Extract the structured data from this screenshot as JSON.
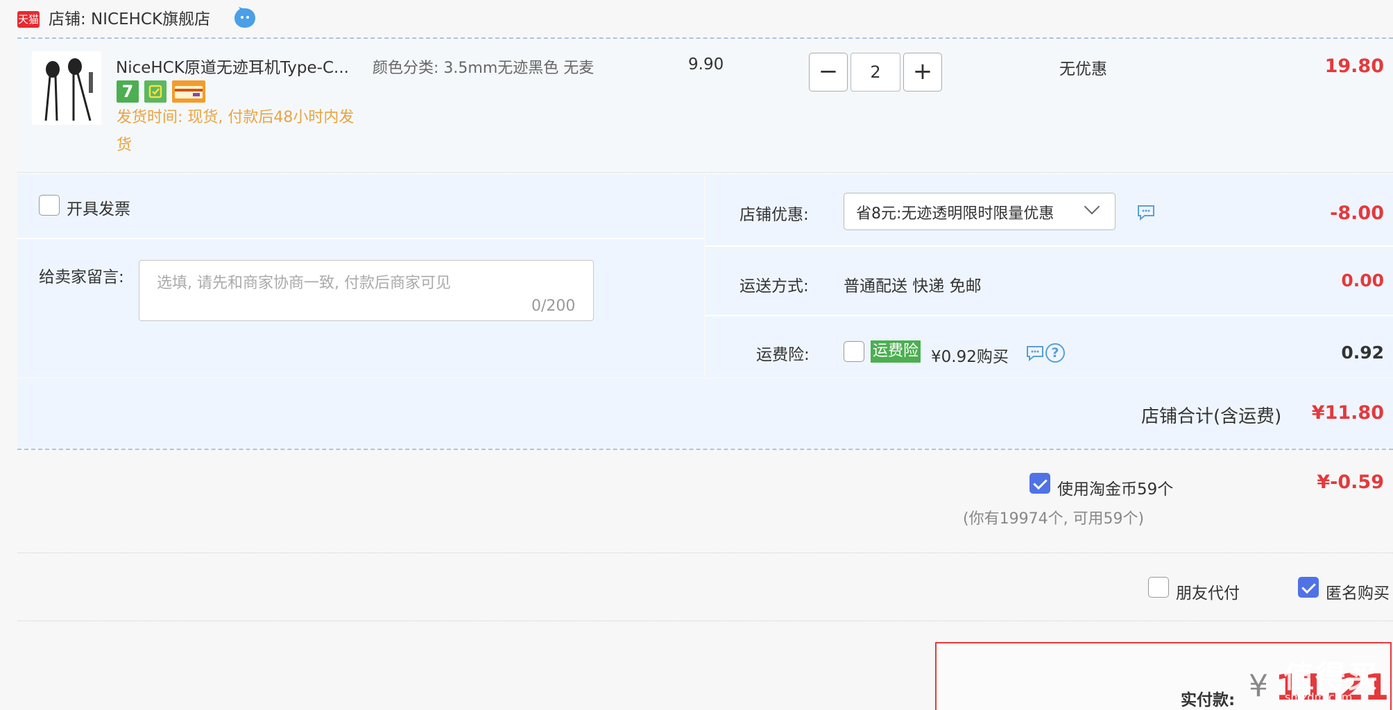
{
  "shop": {
    "platform_logo": "天猫",
    "label": "店铺: NICEHCK旗舰店",
    "chat_icon": "wangwang-chat-icon"
  },
  "product": {
    "title": "NiceHCK原道无迹耳机Type-C...",
    "sku": "颜色分类: 3.5mm无迹黑色 无麦",
    "ship_time": "发货时间: 现货, 付款后48小时内发货",
    "price": "9.90",
    "quantity": "2",
    "minus_label": "−",
    "plus_label": "+",
    "discount": "无优惠",
    "subtotal": "19.80",
    "badges": [
      "seven-day-return-icon",
      "shipping-guarantee-icon",
      "credit-card-icon"
    ],
    "badge_7_text": "7"
  },
  "options": {
    "invoice_label": "开具发票",
    "remark_label": "给卖家留言:",
    "remark_placeholder": "选填, 请先和商家协商一致, 付款后商家可见",
    "remark_count": "0/200",
    "coupon_label": "店铺优惠:",
    "coupon_selected": "省8元:无迹透明限时限量优惠",
    "coupon_value": "-8.00",
    "shipping_label": "运送方式:",
    "shipping_value": "普通配送 快递 免邮",
    "shipping_cost": "0.00",
    "insurance_label": "运费险:",
    "insurance_tag": "运费险",
    "insurance_price": "¥0.92购买",
    "insurance_cost": "0.92",
    "help_glyph": "?"
  },
  "shop_total": {
    "label": "店铺合计(含运费)",
    "value": "¥11.80"
  },
  "coins": {
    "label": "使用淘金币59个",
    "value": "¥-0.59",
    "note": "(你有19974个, 可用59个)"
  },
  "extras": {
    "friend_pay_label": "朋友代付",
    "anonymous_label": "匿名购买"
  },
  "payment": {
    "label": "实付款:",
    "currency": "¥",
    "value": "11.21"
  },
  "watermark": {
    "text": "值得买",
    "sub": "smzdm.com"
  },
  "colors": {
    "price_red": "#e4393c",
    "ship_orange": "#e8a442",
    "panel_blue": "#eef5fe",
    "checkbox_blue": "#4f72e5",
    "insurance_green": "#4caf50",
    "tmall_red": "#e8292f"
  }
}
